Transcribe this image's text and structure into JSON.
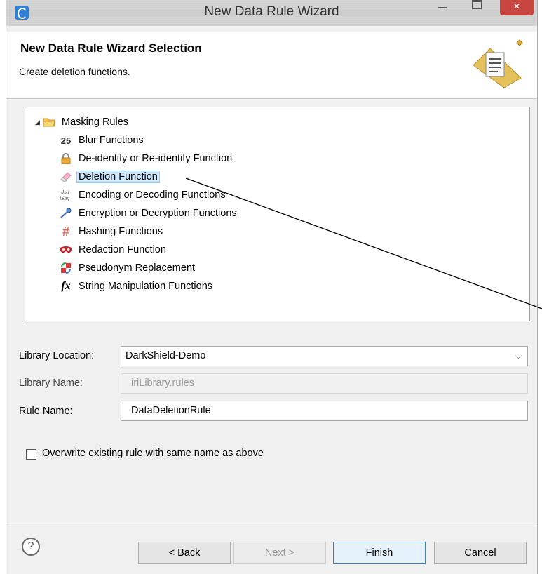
{
  "window": {
    "title": "New Data Rule Wizard",
    "close_glyph": "×"
  },
  "banner": {
    "title": "New Data Rule Wizard Selection",
    "subtitle": "Create deletion functions."
  },
  "tree": {
    "root": {
      "label": "Masking Rules",
      "icon": "folder-open-icon",
      "expander": "◢"
    },
    "items": [
      {
        "label": "Blur Functions",
        "icon": "blur-icon",
        "glyph": "25"
      },
      {
        "label": "De-identify or Re-identify Function",
        "icon": "lock-icon",
        "glyph": ""
      },
      {
        "label": "Deletion Function",
        "icon": "eraser-icon",
        "glyph": "",
        "selected": true
      },
      {
        "label": "Encoding or Decoding Functions",
        "icon": "encoding-icon",
        "glyph": "dhri\niSmj"
      },
      {
        "label": "Encryption or Decryption Functions",
        "icon": "key-icon",
        "glyph": ""
      },
      {
        "label": "Hashing Functions",
        "icon": "hash-icon",
        "glyph": "#"
      },
      {
        "label": "Redaction Function",
        "icon": "redaction-mask-icon",
        "glyph": ""
      },
      {
        "label": "Pseudonym Replacement",
        "icon": "pseudonym-icon",
        "glyph": ""
      },
      {
        "label": "String Manipulation Functions",
        "icon": "function-icon",
        "glyph": "fx"
      }
    ]
  },
  "form": {
    "library_location_label": "Library Location:",
    "library_location_value": "DarkShield-Demo",
    "dropdown_glyph": "⌵",
    "library_name_label": "Library Name:",
    "library_name_value": "iriLibrary.rules",
    "rule_name_label": "Rule Name:",
    "rule_name_value": "DataDeletionRule",
    "overwrite_label": "Overwrite existing rule with same name as above",
    "overwrite_checked": false
  },
  "buttons": {
    "help": "?",
    "back": "< Back",
    "next": "Next >",
    "finish": "Finish",
    "cancel": "Cancel"
  },
  "colors": {
    "selection_bg": "#cde8ff",
    "close_red": "#c7463f",
    "default_button_border": "#3c7fb1"
  }
}
